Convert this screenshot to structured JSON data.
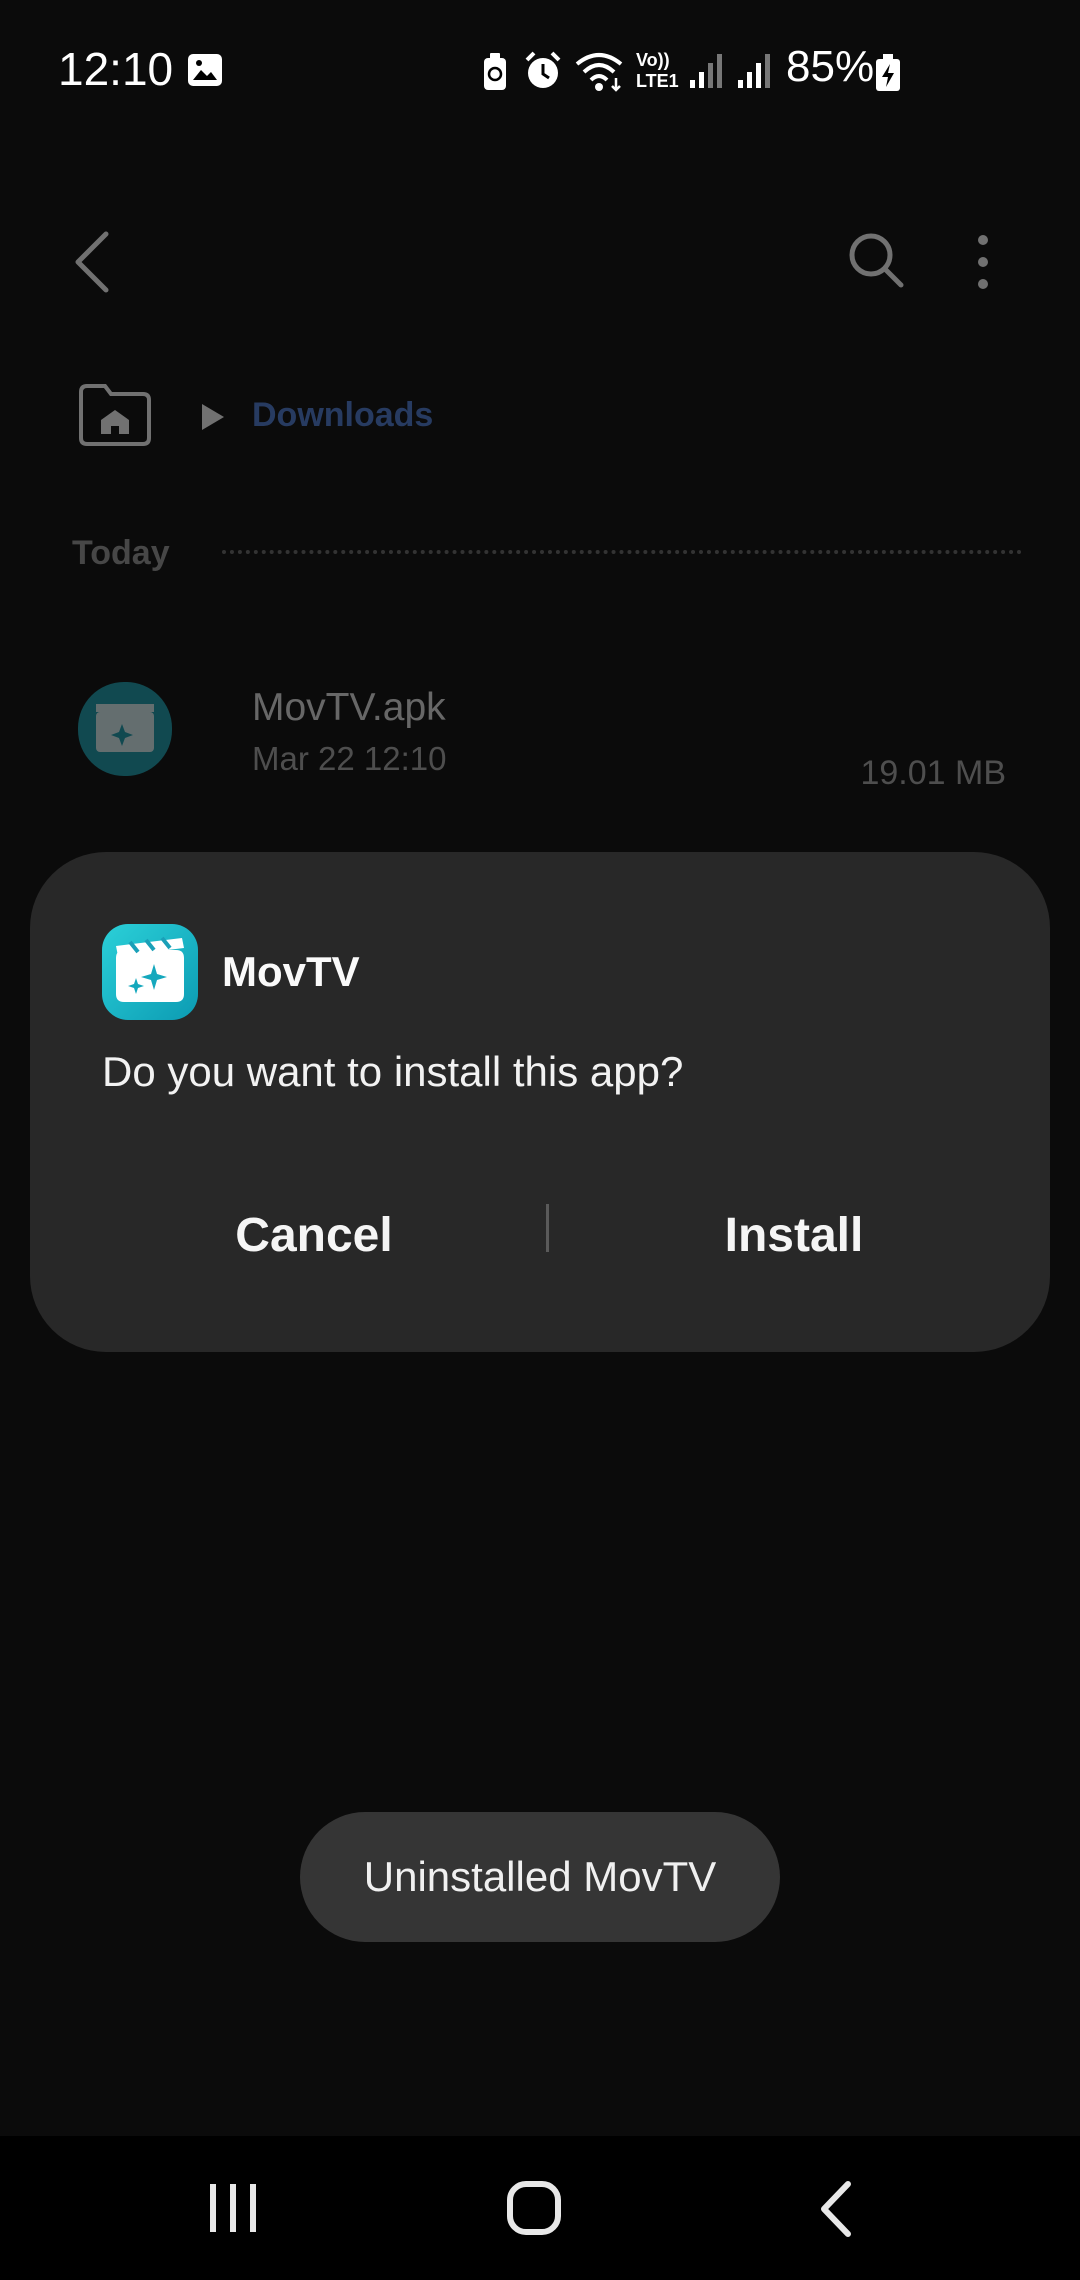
{
  "status_bar": {
    "time": "12:10",
    "battery_percent": "85%",
    "network_label": "LTE1",
    "volte_label": "Vo))",
    "icons": [
      "gallery-icon",
      "battery-saver-icon",
      "alarm-icon",
      "wifi-icon",
      "volte-lte-icon",
      "signal-icon",
      "signal-icon",
      "battery-charging-icon"
    ]
  },
  "app_bar": {
    "icons": [
      "back-arrow-icon",
      "search-icon",
      "more-options-icon"
    ]
  },
  "breadcrumb": {
    "home_icon": "home-folder-icon",
    "separator_icon": "chevron-right-icon",
    "current": "Downloads"
  },
  "section": {
    "header": "Today"
  },
  "file": {
    "name": "MovTV.apk",
    "date": "Mar 22 12:10",
    "size": "19.01 MB",
    "icon": "movtv-app-icon"
  },
  "dialog": {
    "app_name": "MovTV",
    "message": "Do you want to install this app?",
    "cancel_label": "Cancel",
    "install_label": "Install",
    "icon": "movtv-app-icon"
  },
  "toast": {
    "text": "Uninstalled MovTV"
  },
  "nav_bar": {
    "icons": [
      "recents-icon",
      "home-icon",
      "back-icon"
    ]
  },
  "colors": {
    "background": "#0b0b0b",
    "dialog": "#282828",
    "toast": "#353535",
    "breadcrumb_link": "#4f7fd8",
    "app_icon": "#1aa0b0"
  }
}
